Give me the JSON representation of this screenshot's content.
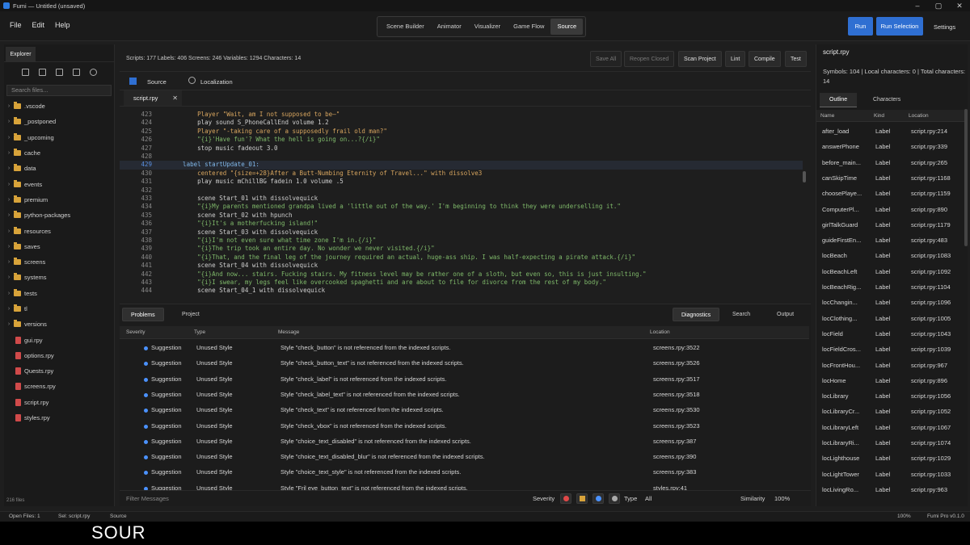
{
  "window": {
    "title": "Fumi — Untitled (unsaved)",
    "controls": [
      "–",
      "▢",
      "✕"
    ]
  },
  "menu": [
    "File",
    "Edit",
    "Help"
  ],
  "modes": {
    "items": [
      "Scene Builder",
      "Animator",
      "Visualizer",
      "Game Flow",
      "Source"
    ],
    "active": "Source"
  },
  "toolbar": {
    "run": "Run",
    "run_selection": "Run Selection",
    "settings": "Settings"
  },
  "explorer": {
    "tab": "Explorer",
    "search_placeholder": "Search files...",
    "folders": [
      ".vscode",
      "_postponed",
      "_upcoming",
      "cache",
      "data",
      "events",
      "premium",
      "python-packages",
      "resources",
      "saves",
      "screens",
      "systems",
      "tests",
      "tl",
      "versions"
    ],
    "files": [
      "gui.rpy",
      "options.rpy",
      "Quests.rpy",
      "screens.rpy",
      "script.rpy",
      "styles.rpy"
    ],
    "count": "216 files"
  },
  "stats": "Scripts: 177   Labels: 406   Screens: 246   Variables: 1294   Characters: 14",
  "actions": [
    "Save All",
    "Reopen Closed",
    "Scan Project",
    "Lint",
    "Compile",
    "Test"
  ],
  "view_tabs": [
    "Source",
    "Localization"
  ],
  "open_file": "script.rpy",
  "code": {
    "current": "429",
    "lines": [
      {
        "n": "423",
        "t": "        Player \"Wait, am I not supposed to be—\""
      },
      {
        "n": "424",
        "t": "        play sound S_PhoneCallEnd volume 1.2"
      },
      {
        "n": "425",
        "t": "        Player \"-taking care of a supposedly frail old man?\""
      },
      {
        "n": "426",
        "t": "        \"{i}'Have fun'? What the hell is going on...?{/i}\""
      },
      {
        "n": "427",
        "t": "        stop music fadeout 3.0"
      },
      {
        "n": "428",
        "t": ""
      },
      {
        "n": "429",
        "t": "    label startUpdate_01:"
      },
      {
        "n": "430",
        "t": "        centered \"{size=+28}After a Butt-Numbing Eternity of Travel...\" with dissolve3"
      },
      {
        "n": "431",
        "t": "        play music mChillBG fadein 1.0 volume .5"
      },
      {
        "n": "432",
        "t": ""
      },
      {
        "n": "433",
        "t": "        scene Start_01 with dissolvequick"
      },
      {
        "n": "434",
        "t": "        \"{i}My parents mentioned grandpa lived a 'little out of the way.' I'm beginning to think they were underselling it.\""
      },
      {
        "n": "435",
        "t": "        scene Start_02 with hpunch"
      },
      {
        "n": "436",
        "t": "        \"{i}It's a motherfucking island!\""
      },
      {
        "n": "437",
        "t": "        scene Start_03 with dissolvequick"
      },
      {
        "n": "438",
        "t": "        \"{i}I'm not even sure what time zone I'm in.{/i}\""
      },
      {
        "n": "439",
        "t": "        \"{i}The trip took an entire day. No wonder we never visited.{/i}\""
      },
      {
        "n": "440",
        "t": "        \"{i}That, and the final leg of the journey required an actual, huge-ass ship. I was half-expecting a pirate attack.{/i}\""
      },
      {
        "n": "441",
        "t": "        scene Start_04 with dissolvequick"
      },
      {
        "n": "442",
        "t": "        \"{i}And now... stairs. Fucking stairs. My fitness level may be rather one of a sloth, but even so, this is just insulting.\""
      },
      {
        "n": "443",
        "t": "        \"{i}I swear, my legs feel like overcooked spaghetti and are about to file for divorce from the rest of my body.\""
      },
      {
        "n": "444",
        "t": "        scene Start_04_1 with dissolvequick"
      }
    ]
  },
  "bottom": {
    "tabs_left": [
      "Problems",
      "Project"
    ],
    "tabs_right": [
      "Diagnostics",
      "Search",
      "Output"
    ],
    "columns": [
      "Severity",
      "Type",
      "Message",
      "Location"
    ],
    "rows": [
      {
        "sev": "Suggestion",
        "type": "Unused Style",
        "msg": "Style \"check_button\" is not referenced from the indexed scripts.",
        "loc": "screens.rpy:3522"
      },
      {
        "sev": "Suggestion",
        "type": "Unused Style",
        "msg": "Style \"check_button_text\" is not referenced from the indexed scripts.",
        "loc": "screens.rpy:3526"
      },
      {
        "sev": "Suggestion",
        "type": "Unused Style",
        "msg": "Style \"check_label\" is not referenced from the indexed scripts.",
        "loc": "screens.rpy:3517"
      },
      {
        "sev": "Suggestion",
        "type": "Unused Style",
        "msg": "Style \"check_label_text\" is not referenced from the indexed scripts.",
        "loc": "screens.rpy:3518"
      },
      {
        "sev": "Suggestion",
        "type": "Unused Style",
        "msg": "Style \"check_text\" is not referenced from the indexed scripts.",
        "loc": "screens.rpy:3530"
      },
      {
        "sev": "Suggestion",
        "type": "Unused Style",
        "msg": "Style \"check_vbox\" is not referenced from the indexed scripts.",
        "loc": "screens.rpy:3523"
      },
      {
        "sev": "Suggestion",
        "type": "Unused Style",
        "msg": "Style \"choice_text_disabled\" is not referenced from the indexed scripts.",
        "loc": "screens.rpy:387"
      },
      {
        "sev": "Suggestion",
        "type": "Unused Style",
        "msg": "Style \"choice_text_disabled_blur\" is not referenced from the indexed scripts.",
        "loc": "screens.rpy:390"
      },
      {
        "sev": "Suggestion",
        "type": "Unused Style",
        "msg": "Style \"choice_text_style\" is not referenced from the indexed scripts.",
        "loc": "screens.rpy:383"
      },
      {
        "sev": "Suggestion",
        "type": "Unused Style",
        "msg": "Style \"Fril eye_button_text\" is not referenced from the indexed scripts.",
        "loc": "styles.rpy:41"
      }
    ],
    "filter_placeholder": "Filter Messages",
    "severity_label": "Severity",
    "type_label": "Type",
    "type_value": "All",
    "similarity_label": "Similarity",
    "similarity_value": "100%"
  },
  "right": {
    "title": "script.rpy",
    "info": "Symbols: 104 | Local characters: 0 | Total characters: 14",
    "tabs": [
      "Outline",
      "Characters"
    ],
    "columns": [
      "Name",
      "Kind",
      "Location"
    ],
    "rows": [
      {
        "name": "after_load",
        "kind": "Label",
        "loc": "script.rpy:214"
      },
      {
        "name": "answerPhone",
        "kind": "Label",
        "loc": "script.rpy:339"
      },
      {
        "name": "before_main...",
        "kind": "Label",
        "loc": "script.rpy:265"
      },
      {
        "name": "canSkipTime",
        "kind": "Label",
        "loc": "script.rpy:1168"
      },
      {
        "name": "choosePlaye...",
        "kind": "Label",
        "loc": "script.rpy:1159"
      },
      {
        "name": "ComputerPl...",
        "kind": "Label",
        "loc": "script.rpy:890"
      },
      {
        "name": "girlTalkGuard",
        "kind": "Label",
        "loc": "script.rpy:1179"
      },
      {
        "name": "guideFirstEn...",
        "kind": "Label",
        "loc": "script.rpy:483"
      },
      {
        "name": "locBeach",
        "kind": "Label",
        "loc": "script.rpy:1083"
      },
      {
        "name": "locBeachLeft",
        "kind": "Label",
        "loc": "script.rpy:1092"
      },
      {
        "name": "locBeachRig...",
        "kind": "Label",
        "loc": "script.rpy:1104"
      },
      {
        "name": "locChangin...",
        "kind": "Label",
        "loc": "script.rpy:1096"
      },
      {
        "name": "locClothing...",
        "kind": "Label",
        "loc": "script.rpy:1005"
      },
      {
        "name": "locField",
        "kind": "Label",
        "loc": "script.rpy:1043"
      },
      {
        "name": "locFieldCros...",
        "kind": "Label",
        "loc": "script.rpy:1039"
      },
      {
        "name": "locFrontHou...",
        "kind": "Label",
        "loc": "script.rpy:967"
      },
      {
        "name": "locHome",
        "kind": "Label",
        "loc": "script.rpy:896"
      },
      {
        "name": "locLibrary",
        "kind": "Label",
        "loc": "script.rpy:1056"
      },
      {
        "name": "locLibraryCr...",
        "kind": "Label",
        "loc": "script.rpy:1052"
      },
      {
        "name": "locLibraryLeft",
        "kind": "Label",
        "loc": "script.rpy:1067"
      },
      {
        "name": "locLibraryRi...",
        "kind": "Label",
        "loc": "script.rpy:1074"
      },
      {
        "name": "locLighthouse",
        "kind": "Label",
        "loc": "script.rpy:1029"
      },
      {
        "name": "locLightTower",
        "kind": "Label",
        "loc": "script.rpy:1033"
      },
      {
        "name": "locLivingRo...",
        "kind": "Label",
        "loc": "script.rpy:963"
      }
    ]
  },
  "statusbar": {
    "open_files": "Open Files: 1",
    "sel": "Sel: script.rpy",
    "mode": "Source",
    "zoom": "100%",
    "version": "Fumi Pro v0.1.0"
  },
  "caption": "SOUR"
}
